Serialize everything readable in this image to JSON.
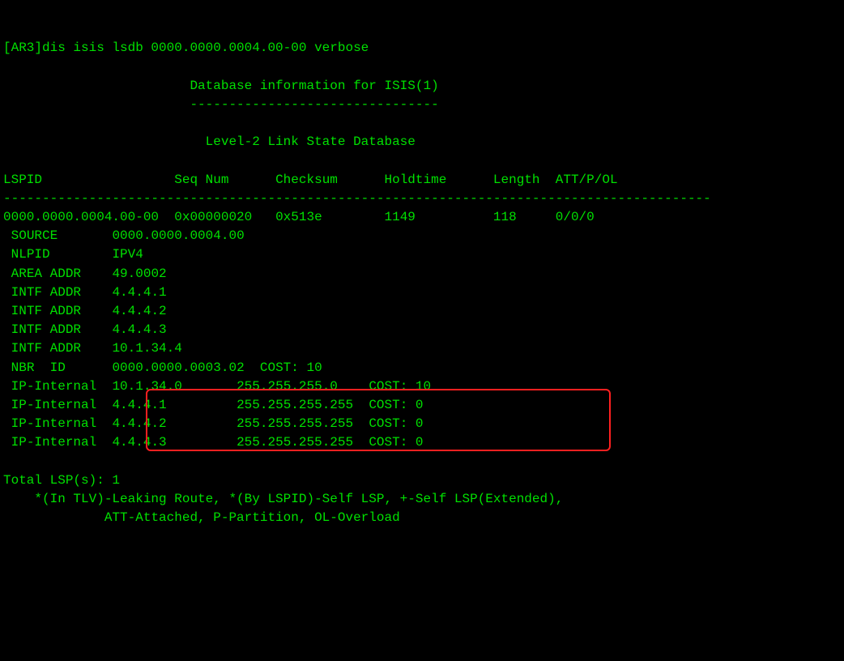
{
  "command": "[AR3]dis isis lsdb 0000.0000.0004.00-00 verbose",
  "header": {
    "title": "Database information for ISIS(1)",
    "underline": "--------------------------------",
    "level": "Level-2 Link State Database"
  },
  "columns": {
    "lspid": "LSPID",
    "seqnum": "Seq Num",
    "checksum": "Checksum",
    "holdtime": "Holdtime",
    "length": "Length",
    "attpol": "ATT/P/OL"
  },
  "separator": "-------------------------------------------------------------------------------------------",
  "entry": {
    "lspid": "0000.0000.0004.00-00",
    "seqnum": "0x00000020",
    "checksum": "0x513e",
    "holdtime": "1149",
    "length": "118",
    "attpol": "0/0/0"
  },
  "details": [
    {
      "label": "SOURCE",
      "value": "0000.0000.0004.00"
    },
    {
      "label": "NLPID",
      "value": "IPV4"
    },
    {
      "label": "AREA ADDR",
      "value": "49.0002"
    },
    {
      "label": "INTF ADDR",
      "value": "4.4.4.1"
    },
    {
      "label": "INTF ADDR",
      "value": "4.4.4.2"
    },
    {
      "label": "INTF ADDR",
      "value": "4.4.4.3"
    },
    {
      "label": "INTF ADDR",
      "value": "10.1.34.4"
    },
    {
      "label": "NBR  ID",
      "value": "0000.0000.0003.02",
      "cost": "COST: 10"
    }
  ],
  "ipinternal": [
    {
      "label": "IP-Internal",
      "ip": "10.1.34.0",
      "mask": "255.255.255.0",
      "cost": "COST: 10"
    },
    {
      "label": "IP-Internal",
      "ip": "4.4.4.1",
      "mask": "255.255.255.255",
      "cost": "COST: 0"
    },
    {
      "label": "IP-Internal",
      "ip": "4.4.4.2",
      "mask": "255.255.255.255",
      "cost": "COST: 0"
    },
    {
      "label": "IP-Internal",
      "ip": "4.4.4.3",
      "mask": "255.255.255.255",
      "cost": "COST: 0"
    }
  ],
  "footer": {
    "total": "Total LSP(s): 1",
    "legend1": "*(In TLV)-Leaking Route, *(By LSPID)-Self LSP, +-Self LSP(Extended),",
    "legend2": "ATT-Attached, P-Partition, OL-Overload"
  }
}
